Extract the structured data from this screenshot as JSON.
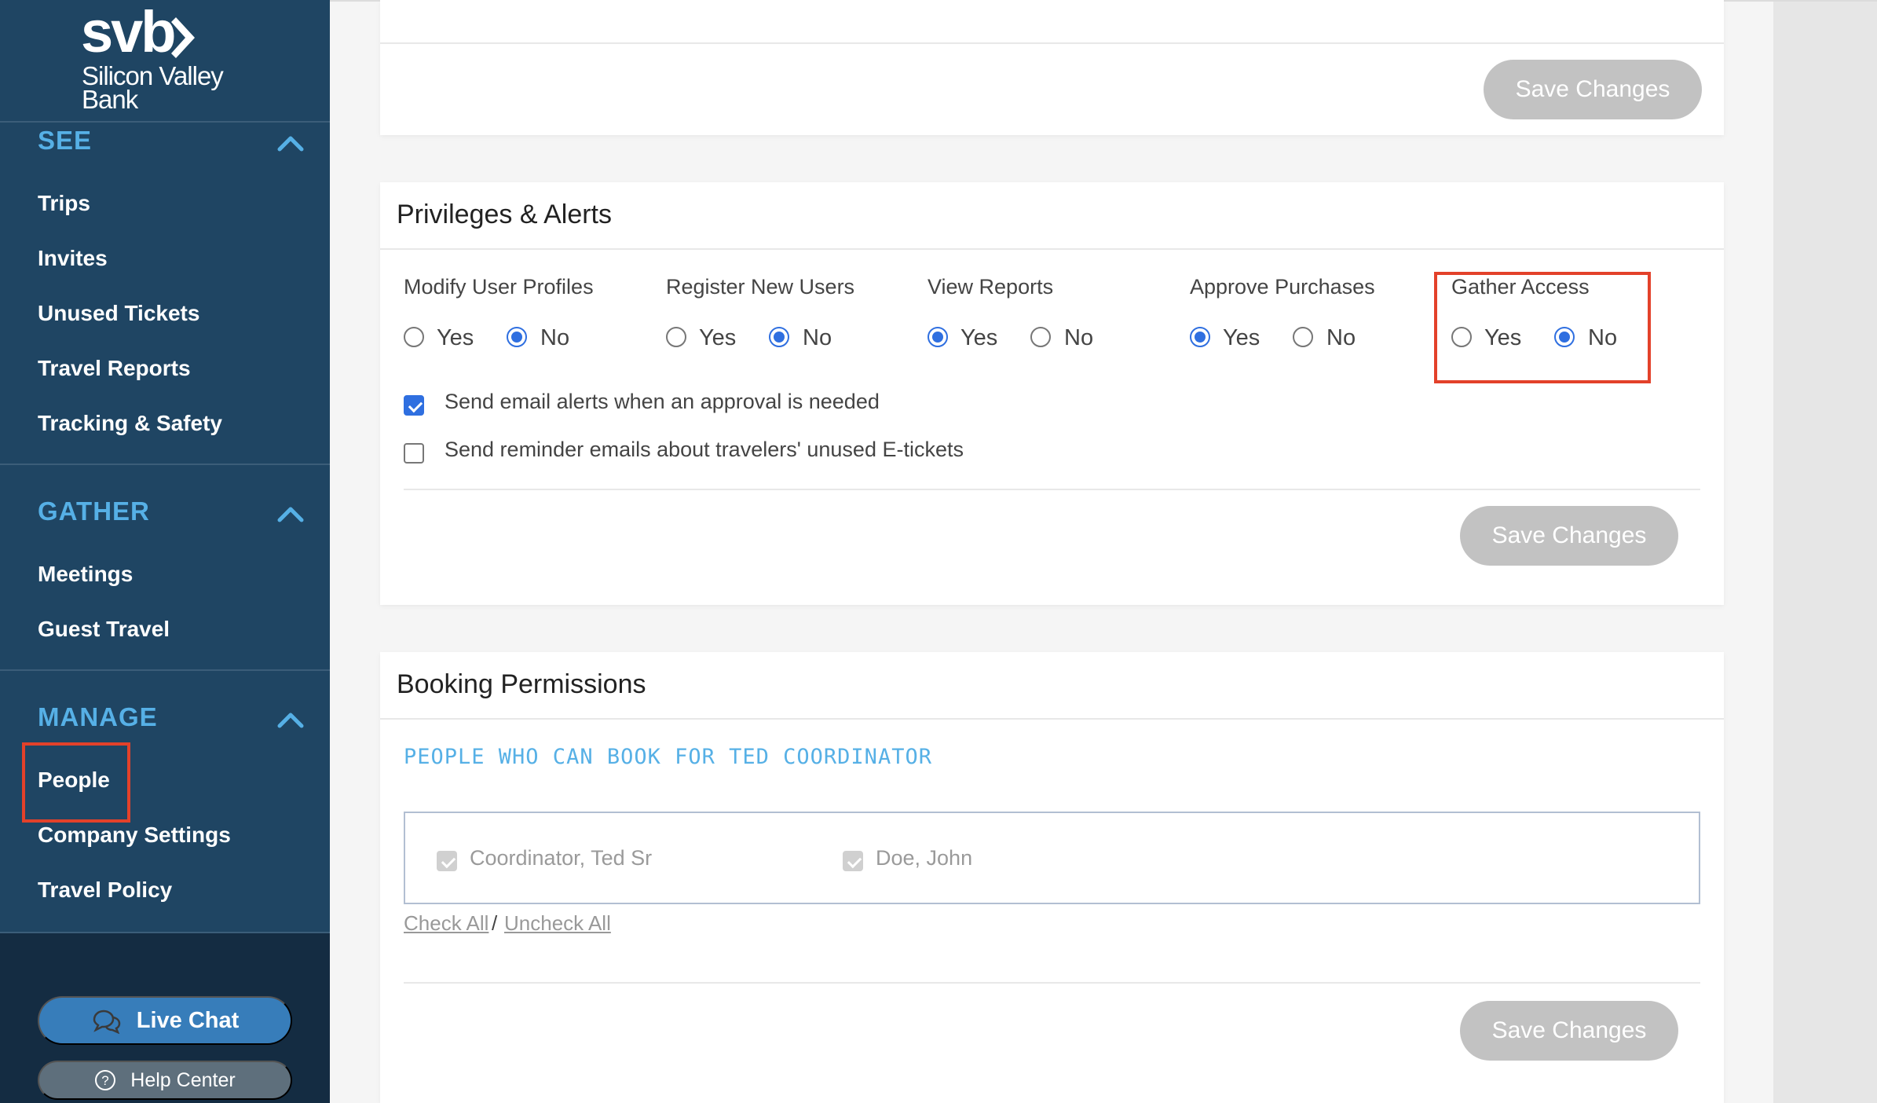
{
  "brand": {
    "logo_text": "svb",
    "name_line1": "Silicon Valley",
    "name_line2": "Bank"
  },
  "sidebar": {
    "sections": [
      {
        "title": "SEE",
        "items": [
          "Trips",
          "Invites",
          "Unused Tickets",
          "Travel Reports",
          "Tracking & Safety"
        ]
      },
      {
        "title": "GATHER",
        "items": [
          "Meetings",
          "Guest Travel"
        ]
      },
      {
        "title": "MANAGE",
        "items": [
          "People",
          "Company Settings",
          "Travel Policy"
        ]
      }
    ],
    "highlighted_item": "People",
    "live_chat_label": "Live Chat",
    "help_center_label": "Help Center"
  },
  "top_card": {
    "save_label": "Save Changes"
  },
  "privileges": {
    "title": "Privileges & Alerts",
    "options": [
      {
        "label": "Modify User Profiles",
        "yes": "Yes",
        "no": "No",
        "value": "No"
      },
      {
        "label": "Register New Users",
        "yes": "Yes",
        "no": "No",
        "value": "No"
      },
      {
        "label": "View Reports",
        "yes": "Yes",
        "no": "No",
        "value": "Yes"
      },
      {
        "label": "Approve Purchases",
        "yes": "Yes",
        "no": "No",
        "value": "Yes"
      },
      {
        "label": "Gather Access",
        "yes": "Yes",
        "no": "No",
        "value": "No"
      }
    ],
    "checkboxes": [
      {
        "label": "Send email alerts when an approval is needed",
        "checked": true
      },
      {
        "label": "Send reminder emails about travelers' unused E-tickets",
        "checked": false
      }
    ],
    "save_label": "Save Changes"
  },
  "booking": {
    "title": "Booking Permissions",
    "subtitle": "PEOPLE WHO CAN BOOK FOR TED COORDINATOR",
    "people": [
      {
        "name": "Coordinator, Ted Sr",
        "checked": true,
        "disabled": true
      },
      {
        "name": "Doe, John",
        "checked": true,
        "disabled": true
      }
    ],
    "check_all": "Check All",
    "separator": "/",
    "uncheck_all": "Uncheck All",
    "save_label": "Save Changes"
  },
  "colors": {
    "sidebar_bg": "#1f4563",
    "sidebar_accent": "#56b0e6",
    "primary_blue": "#2f6fe0",
    "live_chat_bg": "#377dba",
    "disabled_button": "#c2c2c2",
    "highlight_red": "#e3412a"
  }
}
